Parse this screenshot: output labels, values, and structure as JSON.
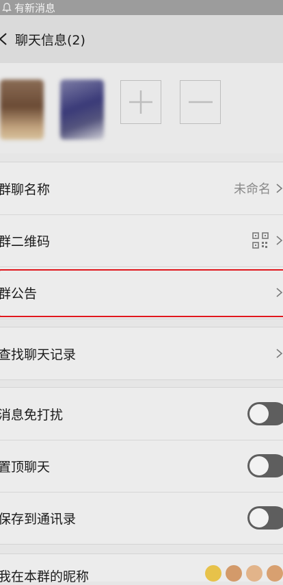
{
  "status_bar": {
    "notification": "有新消息"
  },
  "header": {
    "title": "聊天信息(2)"
  },
  "settings": {
    "group_name": {
      "label": "群聊名称",
      "value": "未命名"
    },
    "group_qr": {
      "label": "群二维码"
    },
    "announcement": {
      "label": "群公告"
    },
    "search_history": {
      "label": "查找聊天记录"
    },
    "mute": {
      "label": "消息免打扰",
      "on": false
    },
    "pin": {
      "label": "置顶聊天",
      "on": false
    },
    "save_contacts": {
      "label": "保存到通讯录",
      "on": false
    },
    "my_nickname": {
      "label": "我在本群的昵称"
    }
  },
  "colors": {
    "highlight": "#e0161c",
    "toggle_off": "#5e5e5e"
  }
}
